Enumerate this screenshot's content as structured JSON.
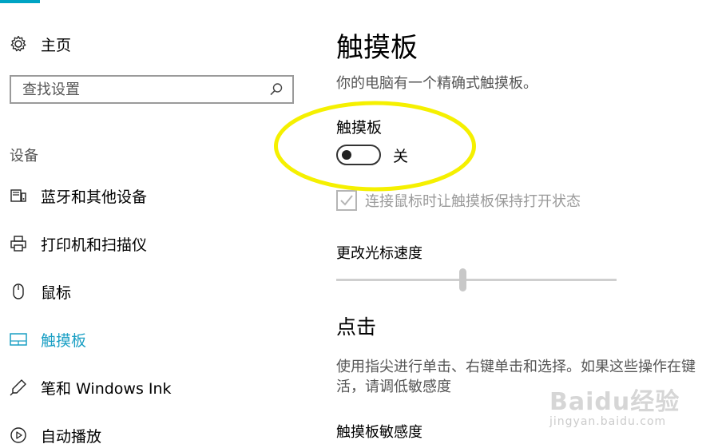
{
  "sidebar": {
    "home_label": "主页",
    "search_placeholder": "查找设置",
    "section_label": "设备",
    "items": [
      {
        "label": "蓝牙和其他设备",
        "icon": "bluetooth-devices-icon"
      },
      {
        "label": "打印机和扫描仪",
        "icon": "printer-icon"
      },
      {
        "label": "鼠标",
        "icon": "mouse-icon"
      },
      {
        "label": "触摸板",
        "icon": "touchpad-icon",
        "active": true
      },
      {
        "label": "笔和 Windows Ink",
        "icon": "pen-icon"
      },
      {
        "label": "自动播放",
        "icon": "autoplay-icon"
      }
    ]
  },
  "main": {
    "title": "触摸板",
    "description": "你的电脑有一个精确式触摸板。",
    "toggle_caption": "触摸板",
    "toggle_state": "关",
    "toggle_on": false,
    "checkbox_label": "连接鼠标时让触摸板保持打开状态",
    "checkbox_checked": true,
    "checkbox_disabled": true,
    "cursor_speed_label": "更改光标速度",
    "cursor_speed_value": 0.45,
    "taps_title": "点击",
    "taps_description_line1": "使用指尖进行单击、右键单击和选择。如果这些操作在键",
    "taps_description_line2": "活，请调低敏感度",
    "sensitivity_label": "触摸板敏感度"
  },
  "watermark": {
    "main": "Baidu经验",
    "sub": "jingyan.baidu.com"
  },
  "colors": {
    "accent": "#1a9fc4",
    "highlight": "#f5f000"
  }
}
